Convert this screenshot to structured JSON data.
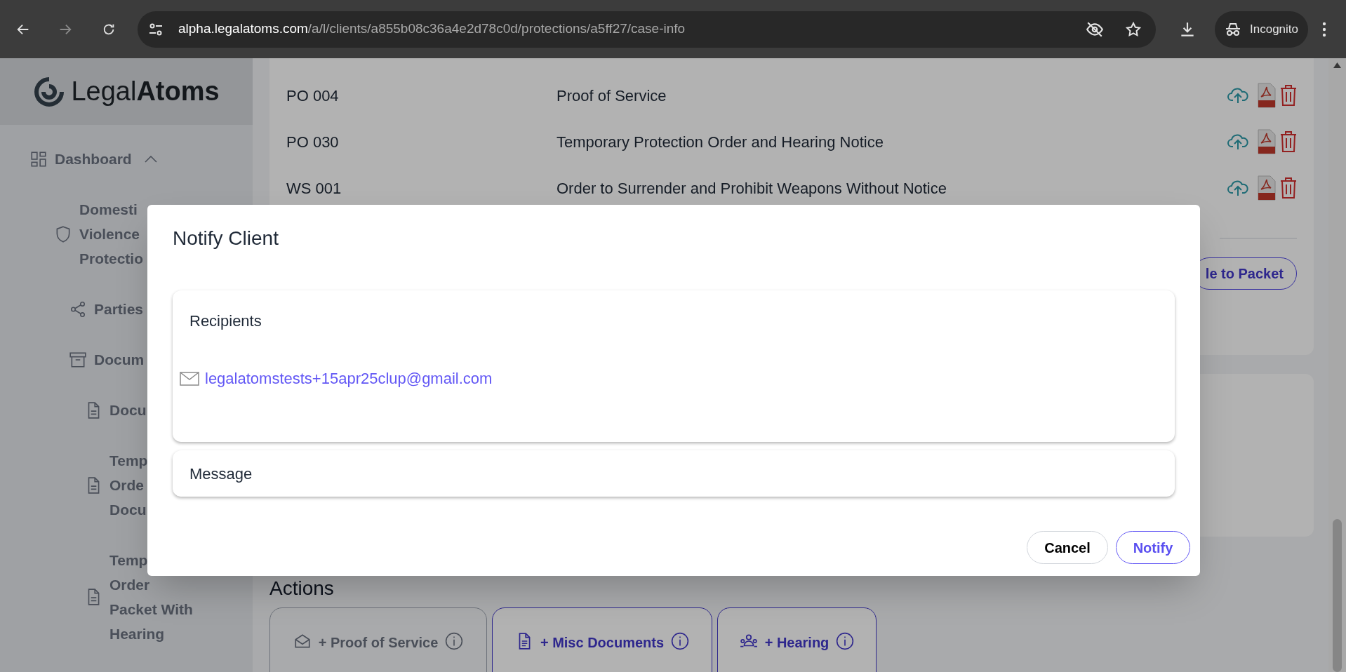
{
  "browser": {
    "url_host": "alpha.legalatoms.com",
    "url_path": "/a/l/clients/a855b08c36a4e2d78c0d/protections/a5ff27/case-info",
    "profile": "Incognito"
  },
  "logo": "Legal**Atoms**",
  "sidebar": {
    "items": [
      {
        "kind": "section",
        "lines": [
          "Dashboard"
        ],
        "expanded": true,
        "children": [
          {
            "kind": "case",
            "lines": [
              "Domesti",
              "Violence",
              "Protectio"
            ],
            "children": [
              {
                "kind": "link",
                "lines": [
                  "Parties"
                ]
              },
              {
                "kind": "folder",
                "lines": [
                  "Docum"
                ],
                "children": [
                  {
                    "kind": "document",
                    "lines": [
                      "Docu"
                    ]
                  },
                  {
                    "kind": "document",
                    "lines": [
                      "Temp",
                      "Orde",
                      "Docu"
                    ]
                  },
                  {
                    "kind": "document",
                    "lines": [
                      "Temp",
                      "Order",
                      "Packet With",
                      "Hearing"
                    ]
                  }
                ]
              }
            ]
          }
        ]
      }
    ]
  },
  "documents": {
    "rows": [
      {
        "code": "PO 004",
        "title": "Proof of Service"
      },
      {
        "code": "PO 030",
        "title": "Temporary Protection Order and Hearing Notice"
      },
      {
        "code": "WS 001",
        "title": "Order to Surrender and Prohibit Weapons Without Notice"
      }
    ],
    "packet_button": "le to Packet"
  },
  "actions": {
    "title": "Actions",
    "buttons": [
      {
        "kind": "proof",
        "label": "+ Proof of Service",
        "disabled": true
      },
      {
        "kind": "misc",
        "label": "+ Misc Documents",
        "disabled": false
      },
      {
        "kind": "hearing",
        "label": "+ Hearing",
        "disabled": false
      }
    ]
  },
  "dialog": {
    "title": "Notify Client",
    "recipients_label": "Recipients",
    "recipients": [
      "legalatomstests+15apr25clup@gmail.com"
    ],
    "message_label": "Message",
    "buttons": [
      {
        "kind": "cancel",
        "label": "Cancel"
      },
      {
        "kind": "primary",
        "label": "Notify"
      }
    ]
  }
}
